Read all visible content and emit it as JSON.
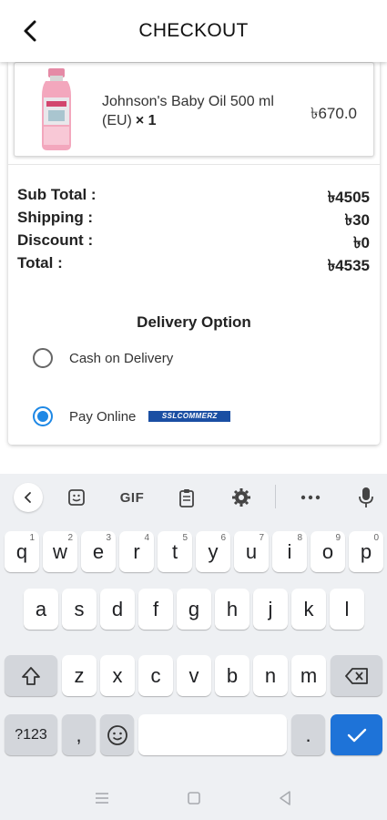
{
  "header": {
    "title": "CHECKOUT"
  },
  "product": {
    "name": "Johnson's Baby Oil 500 ml (EU)",
    "qty": "× 1",
    "price": "৳670.0"
  },
  "summary": {
    "rows": [
      {
        "label": "Sub Total :",
        "value": "৳4505"
      },
      {
        "label": "Shipping :",
        "value": "৳30"
      },
      {
        "label": "Discount :",
        "value": "৳0"
      },
      {
        "label": "Total :",
        "value": "৳4535"
      }
    ]
  },
  "delivery": {
    "title": "Delivery Option",
    "options": [
      {
        "label": "Cash on Delivery",
        "selected": false
      },
      {
        "label": "Pay Online",
        "selected": true,
        "badge": "SSLCOMMERZ"
      }
    ]
  },
  "keyboard": {
    "toolbar": {
      "gif": "GIF"
    },
    "row1": [
      {
        "key": "q",
        "hint": "1"
      },
      {
        "key": "w",
        "hint": "2"
      },
      {
        "key": "e",
        "hint": "3"
      },
      {
        "key": "r",
        "hint": "4"
      },
      {
        "key": "t",
        "hint": "5"
      },
      {
        "key": "y",
        "hint": "6"
      },
      {
        "key": "u",
        "hint": "7"
      },
      {
        "key": "i",
        "hint": "8"
      },
      {
        "key": "o",
        "hint": "9"
      },
      {
        "key": "p",
        "hint": "0"
      }
    ],
    "row2": [
      "a",
      "s",
      "d",
      "f",
      "g",
      "h",
      "j",
      "k",
      "l"
    ],
    "row3": [
      "z",
      "x",
      "c",
      "v",
      "b",
      "n",
      "m"
    ],
    "symbols_label": "?123",
    "comma": ",",
    "period": "."
  },
  "colors": {
    "accent": "#1e88e5",
    "keyboard_bg": "#eef0f3",
    "enter_key": "#1e73d8"
  },
  "icons": [
    "back-arrow-icon",
    "sticker-icon",
    "clipboard-icon",
    "gear-icon",
    "more-icon",
    "mic-icon",
    "shift-icon",
    "backspace-icon",
    "emoji-icon",
    "check-icon"
  ]
}
